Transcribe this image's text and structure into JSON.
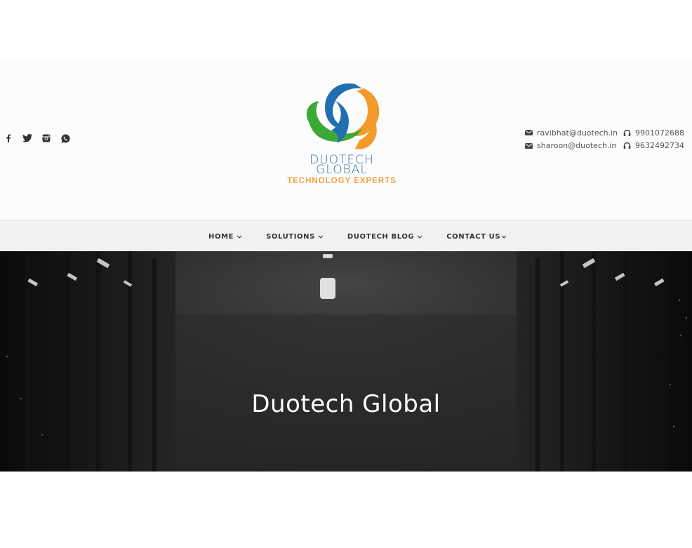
{
  "social": {
    "items": [
      {
        "icon": "facebook-icon"
      },
      {
        "icon": "twitter-icon"
      },
      {
        "icon": "instagram-icon"
      },
      {
        "icon": "whatsapp-icon"
      }
    ]
  },
  "logo": {
    "line1": "DUOTECH",
    "line2": "GLOBAL",
    "tagline": "TECHNOLOGY EXPERTS",
    "colors": {
      "blue": "#1f6fb2",
      "green": "#3aa935",
      "orange": "#f39a2b"
    }
  },
  "contact": {
    "emails": [
      "ravibhat@duotech.in",
      "sharoon@duotech.in"
    ],
    "phones": [
      "9901072688",
      "9632492734"
    ]
  },
  "nav": {
    "home": "HOME",
    "solutions": "SOLUTIONS",
    "blog": "DUOTECH BLOG",
    "contact": "CONTACT US"
  },
  "hero": {
    "title": "Duotech Global"
  }
}
